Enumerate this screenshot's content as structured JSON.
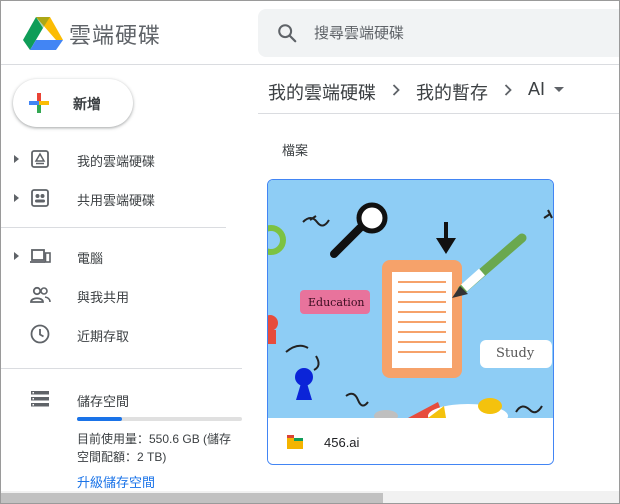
{
  "app": {
    "name": "雲端硬碟"
  },
  "search": {
    "placeholder": "搜尋雲端硬碟"
  },
  "sidebar": {
    "new_label": "新增",
    "items": [
      {
        "label": "我的雲端硬碟",
        "icon": "my-drive-icon",
        "expandable": true
      },
      {
        "label": "共用雲端硬碟",
        "icon": "shared-drives-icon",
        "expandable": true
      },
      {
        "label": "電腦",
        "icon": "computers-icon",
        "expandable": true
      },
      {
        "label": "與我共用",
        "icon": "shared-with-me-icon",
        "expandable": false
      },
      {
        "label": "近期存取",
        "icon": "recent-icon",
        "expandable": false
      }
    ],
    "storage": {
      "title": "儲存空間",
      "used_text": "目前使用量：550.6 GB (儲存",
      "quota_text": "空間配額：2 TB)",
      "used_fraction": 0.27,
      "upgrade_label": "升級儲存空間"
    }
  },
  "breadcrumb": [
    "我的雲端硬碟",
    "我的暫存",
    "AI"
  ],
  "section": {
    "files_label": "檔案"
  },
  "files": [
    {
      "name": "456.ai",
      "thumbnail_texts": [
        "Education",
        "Study"
      ]
    }
  ],
  "colors": {
    "accent": "#1a73e8",
    "card_border": "#4285f4",
    "thumb_bg": "#8ecdf5"
  }
}
